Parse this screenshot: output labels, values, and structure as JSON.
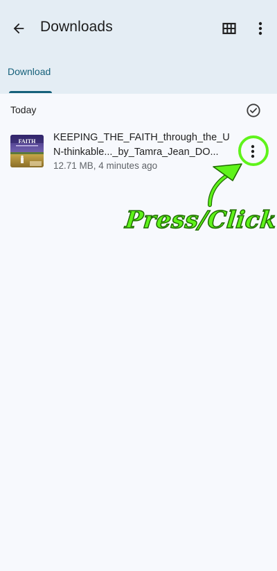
{
  "header": {
    "title": "Downloads",
    "back_icon": "arrow-left-icon",
    "grid_icon": "grid-view-icon",
    "more_icon": "more-vertical-icon"
  },
  "tabs": [
    {
      "label": "Download",
      "selected": true
    }
  ],
  "section": {
    "label": "Today",
    "select_icon": "check-circle-icon"
  },
  "items": [
    {
      "file_name": "KEEPING_THE_FAITH_through_the_UN-thinkable..._by_Tamra_Jean_DO...",
      "meta": "12.71 MB, 4 minutes ago",
      "thumbnail_title": "FAITH",
      "more_icon": "more-vertical-icon"
    }
  ],
  "annotation": {
    "text": "Press/Click",
    "color": "#5ff31b"
  },
  "colors": {
    "appbar_bg": "#e4edf4",
    "page_bg": "#f7f9fd",
    "accent": "#15607a"
  }
}
